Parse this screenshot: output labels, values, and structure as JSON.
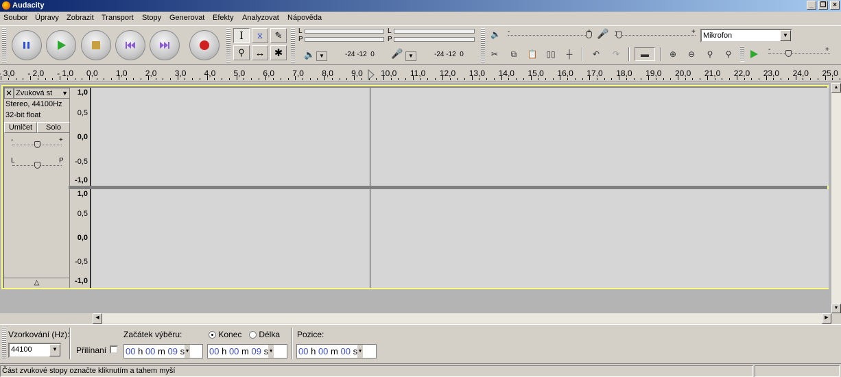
{
  "window": {
    "title": "Audacity"
  },
  "menu": [
    "Soubor",
    "Úpravy",
    "Zobrazit",
    "Transport",
    "Stopy",
    "Generovat",
    "Efekty",
    "Analyzovat",
    "Nápověda"
  ],
  "meters": {
    "play_l": "L",
    "play_r": "P",
    "rec_l": "L",
    "rec_r": "P",
    "play_scale": "-24 -12  0",
    "rec_scale": "-24 -12  0"
  },
  "mixer": {
    "input_source": "Mikrofon",
    "minus": "-",
    "plus": "+"
  },
  "ruler": {
    "labels": [
      "- 3,0",
      "- 2,0",
      "- 1,0",
      "0,0",
      "1,0",
      "2,0",
      "3,0",
      "4,0",
      "5,0",
      "6,0",
      "7,0",
      "8,0",
      "9,0",
      "10,0",
      "11,0",
      "12,0",
      "13,0",
      "14,0",
      "15,0",
      "16,0",
      "17,0",
      "18,0",
      "19,0",
      "20,0",
      "21,0",
      "22,0",
      "23,0",
      "24,0",
      "25,0"
    ]
  },
  "track": {
    "name": "Zvuková st",
    "format_line1": "Stereo, 44100Hz",
    "format_line2": "32-bit float",
    "mute_label": "Umlčet",
    "solo_label": "Solo",
    "gain_minus": "-",
    "gain_plus": "+",
    "pan_left": "L",
    "pan_right": "P",
    "scale": [
      "1,0",
      "0,5",
      "0,0",
      "-0,5",
      "-1,0"
    ]
  },
  "selection": {
    "rate_label": "Vzorkování (Hz):",
    "rate_value": "44100",
    "snap_label": "Přilínaní",
    "start_label": "Začátek výběru:",
    "end_label": "Konec",
    "length_label": "Délka",
    "position_label": "Pozice:",
    "start_time": {
      "h": "00",
      "m": "00",
      "s": "09"
    },
    "end_time": {
      "h": "00",
      "m": "00",
      "s": "09"
    },
    "pos_time": {
      "h": "00",
      "m": "00",
      "s": "00"
    },
    "unit_h": "h",
    "unit_m": "m",
    "unit_s": "s"
  },
  "status": {
    "text": "Část zvukové stopy označte kliknutím a tahem myší"
  }
}
